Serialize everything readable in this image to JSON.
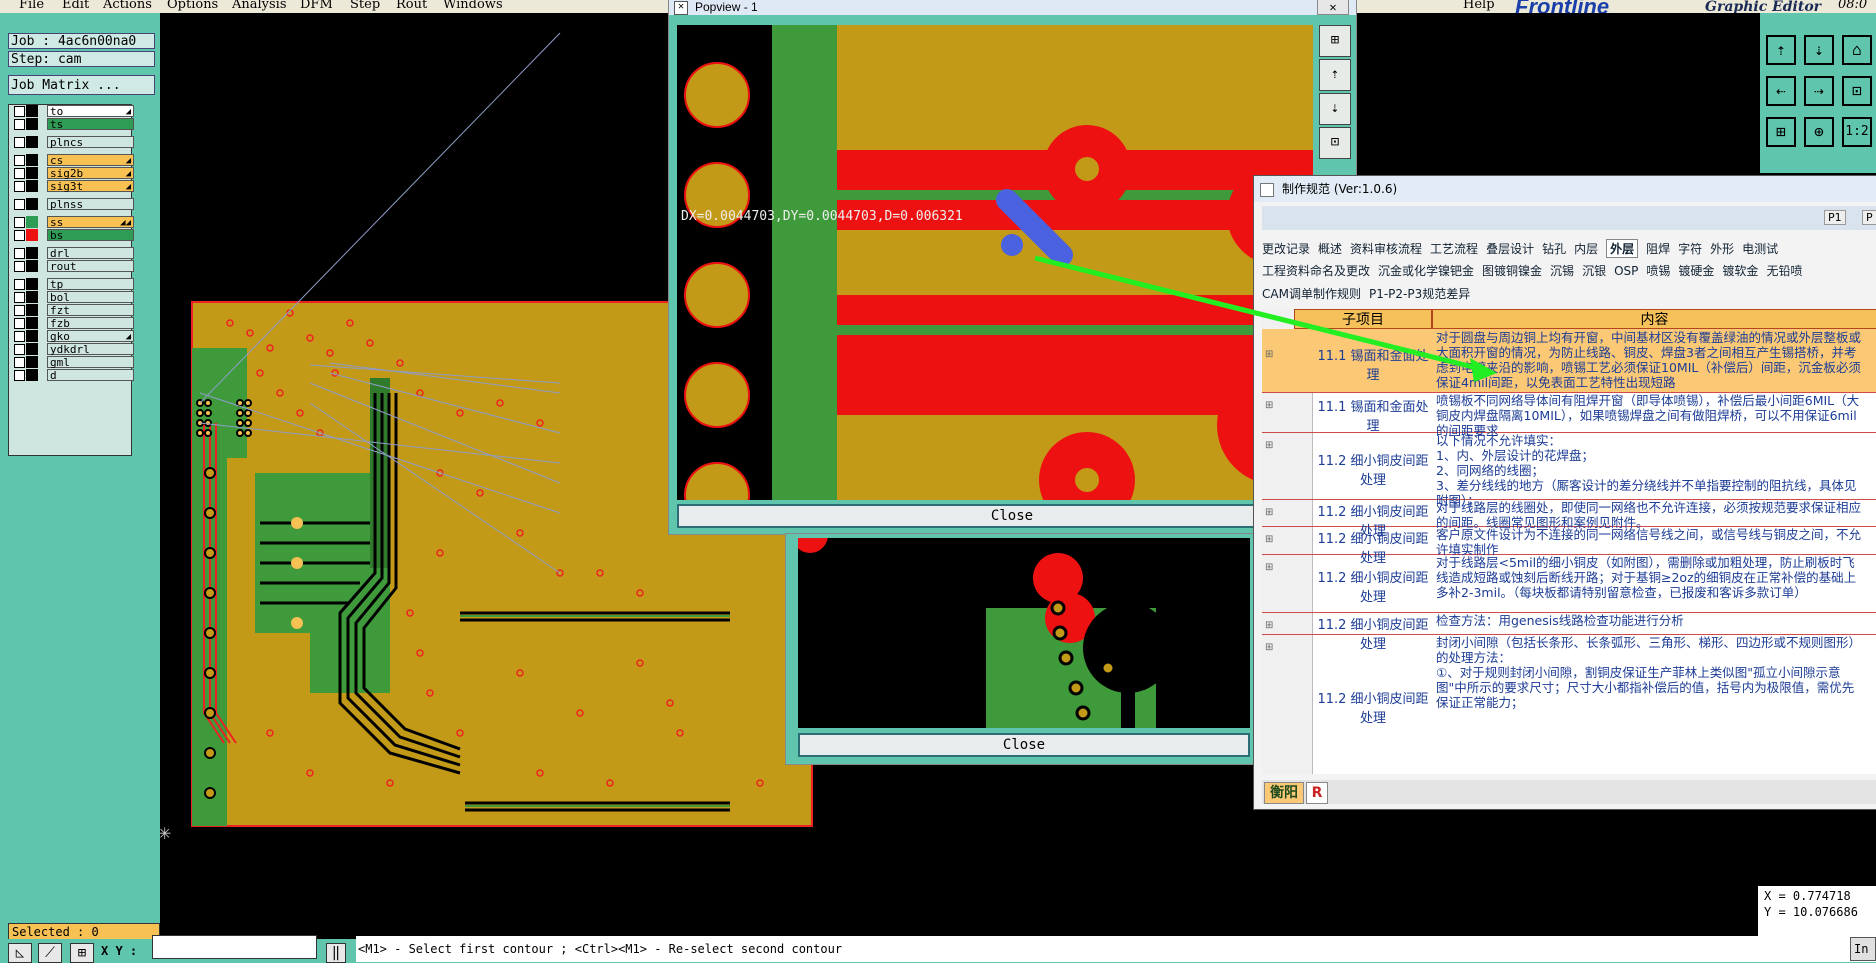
{
  "menu": {
    "items": [
      "File",
      "Edit",
      "Actions",
      "Options",
      "Analysis",
      "DFM",
      "Step",
      "Rout",
      "Windows"
    ],
    "help": "Help",
    "logo": "Frontline",
    "graphic_editor": "Graphic Editor",
    "clock": "08:0"
  },
  "left_panel": {
    "job": "Job : 4ac6n00na0",
    "step": "Step: cam",
    "job_matrix": "Job Matrix ...",
    "layers": [
      {
        "name": "to",
        "color": "#ffffff",
        "swatch": "#000000",
        "flag": "◢"
      },
      {
        "name": "ts",
        "color": "#2e9c55",
        "swatch": "#000000",
        "flag": ""
      },
      {
        "name": "plncs",
        "color": "#cfe5e0",
        "swatch": "#000000",
        "flag": ""
      },
      {
        "name": "cs",
        "color": "#f7c153",
        "swatch": "#000000",
        "flag": "◢"
      },
      {
        "name": "sig2b",
        "color": "#f7c153",
        "swatch": "#000000",
        "flag": "◢"
      },
      {
        "name": "sig3t",
        "color": "#f7c153",
        "swatch": "#000000",
        "flag": "◢"
      },
      {
        "name": "plnss",
        "color": "#cfe5e0",
        "swatch": "#000000",
        "flag": ""
      },
      {
        "name": "ss",
        "color": "#f7c153",
        "swatch": "#2e9c55",
        "flag": "◢◢"
      },
      {
        "name": "bs",
        "color": "#2e9c55",
        "swatch": "#ee1111",
        "flag": ""
      },
      {
        "name": "drl",
        "color": "#cfe5e0",
        "swatch": "#000000",
        "flag": ""
      },
      {
        "name": "rout",
        "color": "#cfe5e0",
        "swatch": "#000000",
        "flag": ""
      },
      {
        "name": "tp",
        "color": "#cfe5e0",
        "swatch": "#000000",
        "flag": ""
      },
      {
        "name": "bol",
        "color": "#cfe5e0",
        "swatch": "#000000",
        "flag": ""
      },
      {
        "name": "fzt",
        "color": "#cfe5e0",
        "swatch": "#000000",
        "flag": ""
      },
      {
        "name": "fzb",
        "color": "#cfe5e0",
        "swatch": "#000000",
        "flag": ""
      },
      {
        "name": "gko",
        "color": "#cfe5e0",
        "swatch": "#000000",
        "flag": "◢"
      },
      {
        "name": "ydkdrl",
        "color": "#cfe5e0",
        "swatch": "#000000",
        "flag": ""
      },
      {
        "name": "gml",
        "color": "#cfe5e0",
        "swatch": "#000000",
        "flag": ""
      },
      {
        "name": "d",
        "color": "#cfe5e0",
        "swatch": "#000000",
        "flag": ""
      }
    ],
    "selected": "Selected : 0"
  },
  "bottom_bar": {
    "xy_label": "X Y :",
    "xy_value": "",
    "status_message": "<M1> - Select first contour ; <Ctrl><M1> - Re-select second contour",
    "right_label": "In"
  },
  "coords": {
    "x": "X = 0.774718",
    "y": "Y = 10.076686"
  },
  "popview": {
    "title": "Popview - 1",
    "measure": "DX=0.0044703,DY=0.0044703,D=0.006321",
    "close_label": "Close"
  },
  "second_popup": {
    "close_label": "Close"
  },
  "spec_window": {
    "title": "制作规范 (Ver:1.0.6)",
    "tabs_row1": [
      "更改记录",
      "概述",
      "资料审核流程",
      "工艺流程",
      "叠层设计",
      "钻孔",
      "内层",
      "外层",
      "阻焊",
      "字符",
      "外形",
      "电测试"
    ],
    "selected_tab": "外层",
    "tabs_row2": [
      "工程资料命名及更改",
      "沉金或化学镍钯金",
      "图镀铜镍金",
      "沉锡",
      "沉银",
      "OSP",
      "喷锡",
      "镀硬金",
      "镀软金",
      "无铅喷"
    ],
    "tabs_row3": [
      "CAM调单制作规则",
      "P1-P2-P3规范差异"
    ],
    "mini_tabs": [
      "P1",
      "P"
    ],
    "columns": [
      "子项目",
      "内容"
    ],
    "rows": [
      {
        "sub": "11.1 锡面和金面处理",
        "text": "对于圆盘与周边铜上均有开窗，中间基材区没有覆盖绿油的情况或外层整板或大面积开窗的情况，为防止线路、铜皮、焊盘3者之间相互产生锡搭桥，并考虑到电镀夹沿的影响，喷锡工艺必须保证10MIL（补偿后）间距，沉金板必须保证4mil间距，以免表面工艺特性出现短路"
      },
      {
        "sub": "11.1 锡面和金面处理",
        "text": "喷锡板不同网络导体间有阻焊开窗（即导体喷锡），补偿后最小间距6MIL（大铜皮内焊盘隔离10MIL），如果喷锡焊盘之间有做阻焊桥，可以不用保证6mil的间距要求"
      },
      {
        "sub": "11.2 细小铜皮间距处理",
        "text": "以下情况不允许填实：\n1、内、外层设计的花焊盘；\n2、同网络的线圈；\n3、差分线线的地方（厮客设计的差分绕线并不单指要控制的阻抗线，具体见附图）；"
      },
      {
        "sub": "11.2 细小铜皮间距处理",
        "text": "对于线路层的线圈处，即使同一网络也不允许连接，必须按规范要求保证相应的间距。线圈常见图形和案例见附件。"
      },
      {
        "sub": "11.2 细小铜皮间距处理",
        "text": "客户原文件设计为不连接的同一网络信号线之间，或信号线与铜皮之间，不允许填实制作"
      },
      {
        "sub": "11.2 细小铜皮间距处理",
        "text": "对于线路层<5mil的细小铜皮（如附图），需删除或加粗处理，防止刷板时飞线造成短路或蚀刻后断线开路；对于基铜≥2oz的细铜皮在正常补偿的基础上多补2-3mil。（每块板都请特别留意检查，已报废和客诉多款订单）"
      },
      {
        "sub": "11.2 细小铜皮间距处理",
        "text": "检查方法：用genesis线路检查功能进行分析"
      },
      {
        "sub": "11.2 细小铜皮间距处理",
        "text": "封闭小间隙（包括长条形、长条弧形、三角形、梯形、四边形或不规则图形）的处理方法：\n①、对于规则封闭小间隙，割铜皮保证生产菲林上类似图\"孤立小间隙示意图\"中所示的要求尺寸；尺寸大小都指补偿后的值，括号内为极限值，需优先保证正常能力；"
      }
    ],
    "footer_left": "衡阳",
    "footer_right": "R"
  }
}
